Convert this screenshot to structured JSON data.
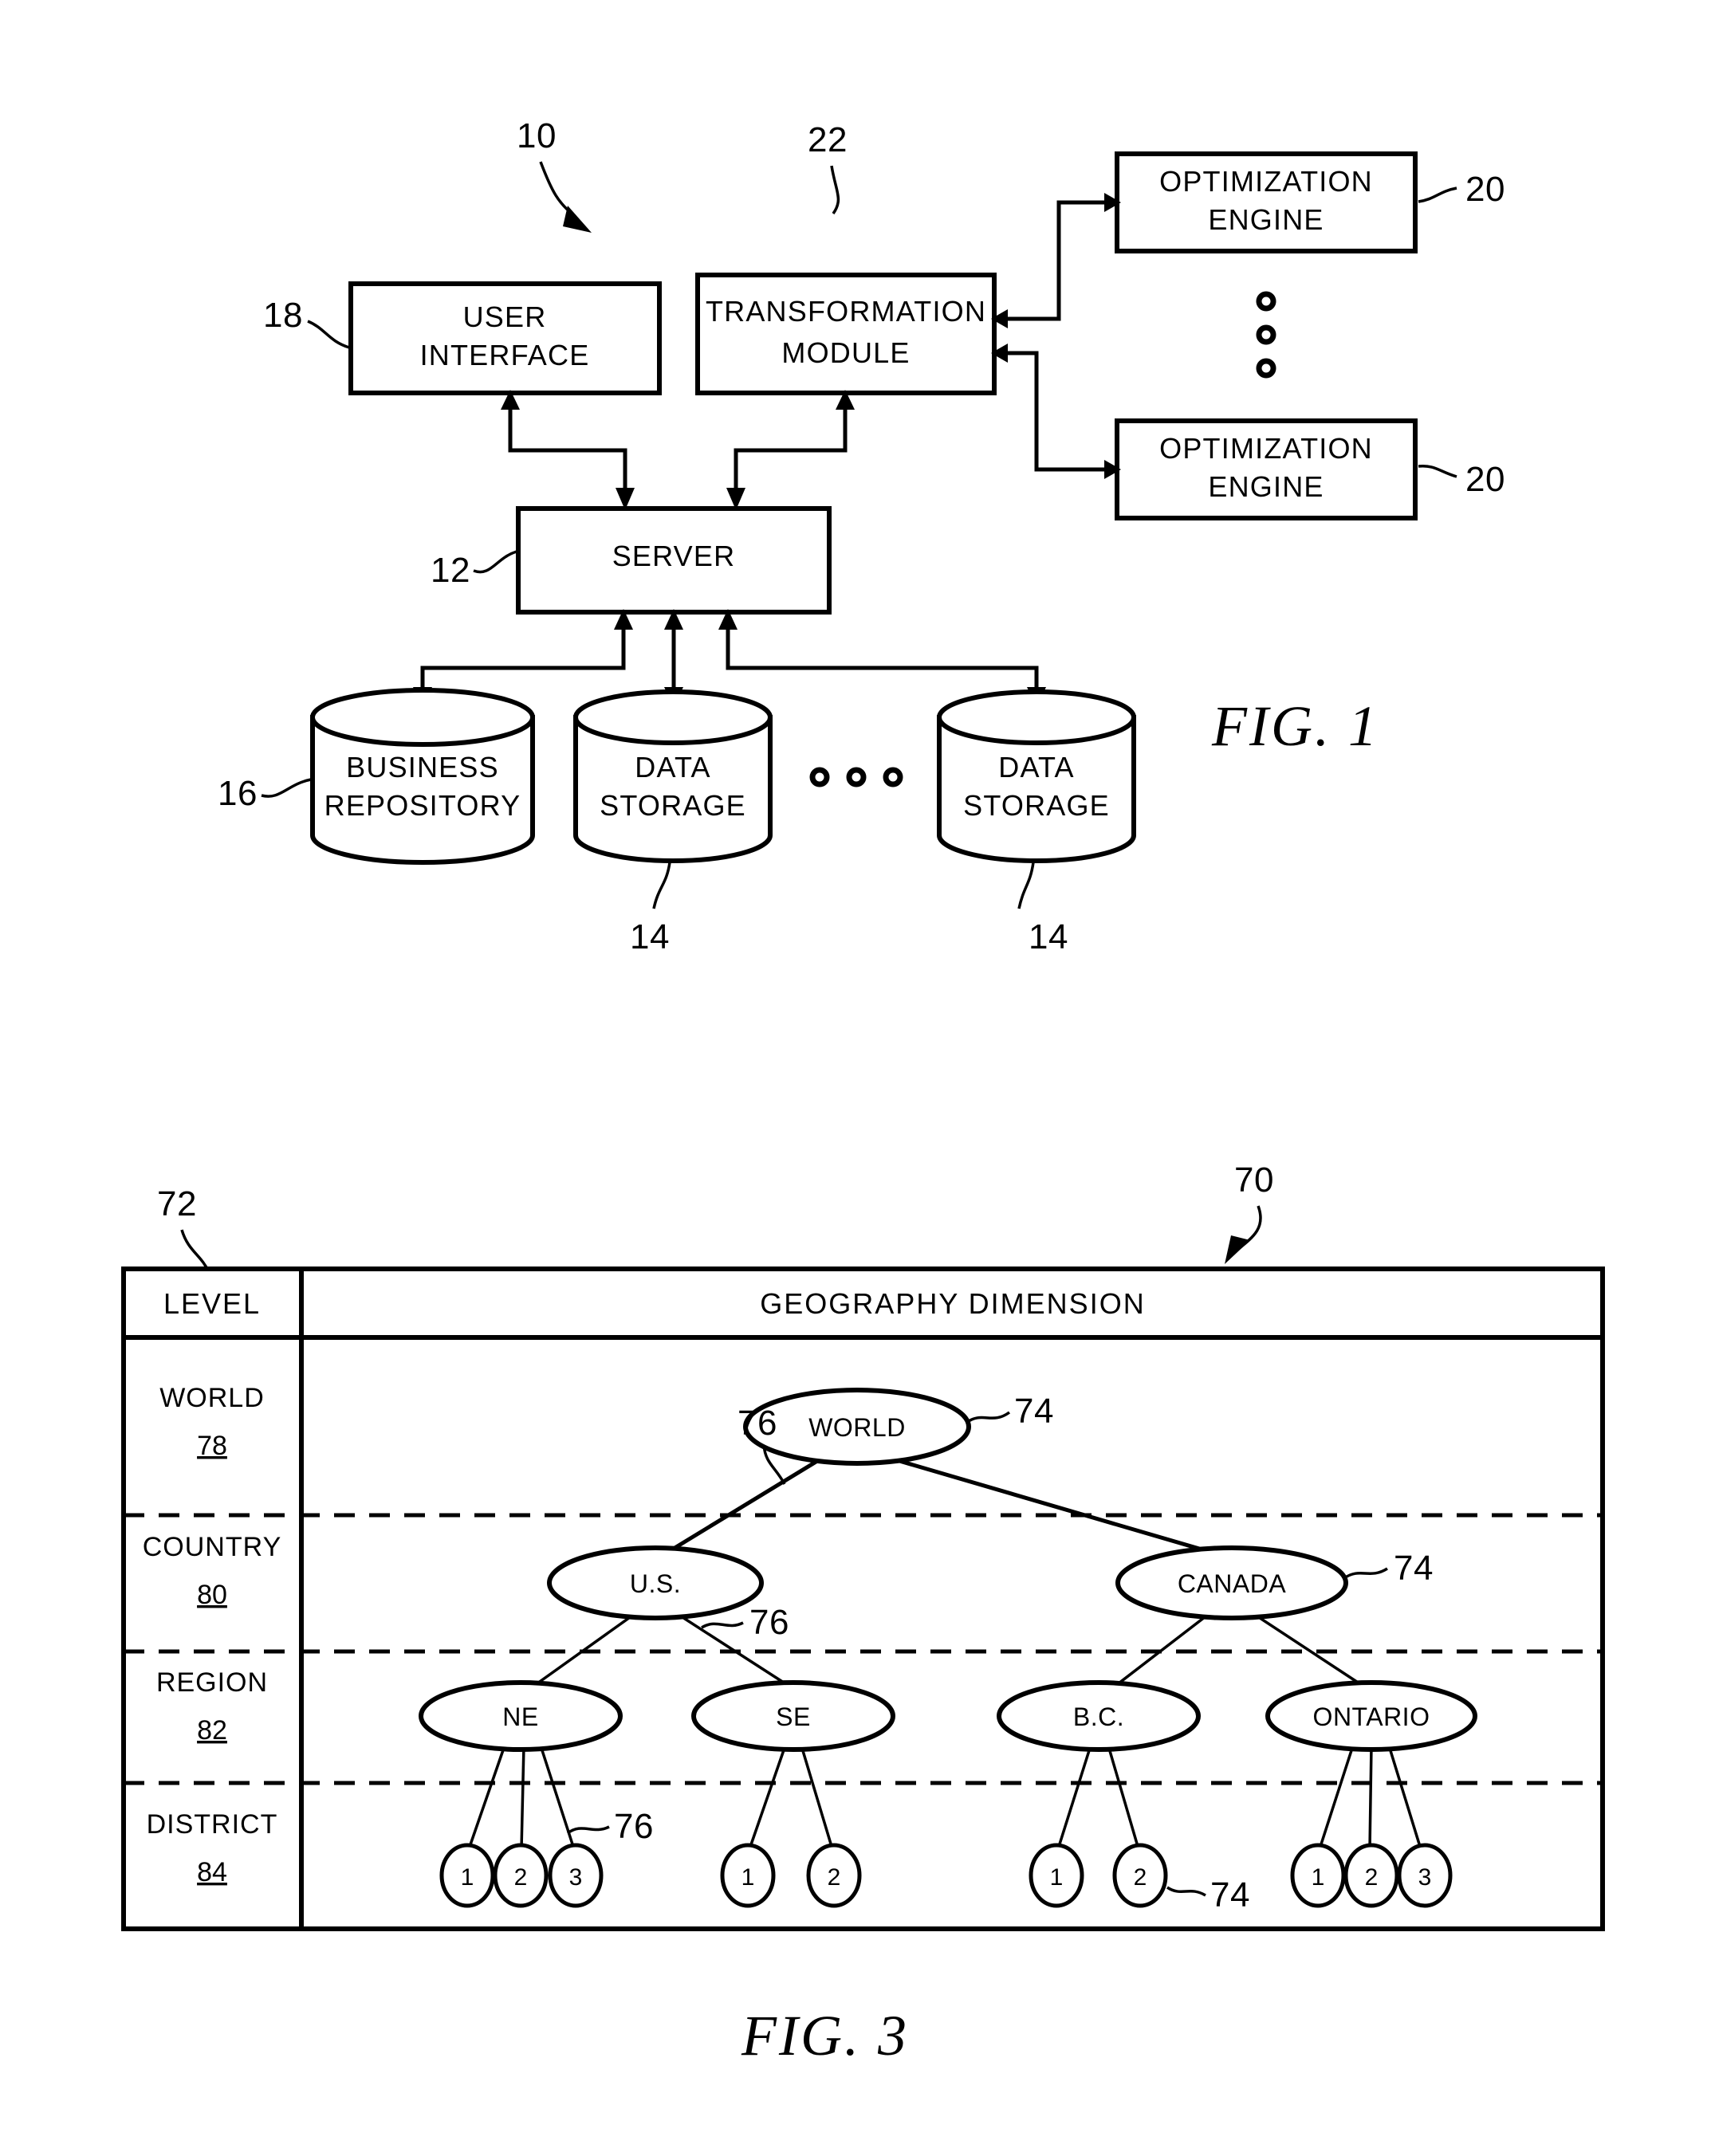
{
  "document": {
    "type": "patent-drawing-sheet",
    "figures": [
      "FIG. 1",
      "FIG. 3"
    ]
  },
  "fig1": {
    "title": "FIG.   1",
    "system_ref": "10",
    "boxes": [
      {
        "id": "user_interface",
        "label_line1": "USER",
        "label_line2": "INTERFACE",
        "ref": "18"
      },
      {
        "id": "transformation_module",
        "label_line1": "TRANSFORMATION",
        "label_line2": "MODULE",
        "ref": "22"
      },
      {
        "id": "optimization_engine_top",
        "label_line1": "OPTIMIZATION",
        "label_line2": "ENGINE",
        "ref": "20"
      },
      {
        "id": "optimization_engine_bottom",
        "label_line1": "OPTIMIZATION",
        "label_line2": "ENGINE",
        "ref": "20"
      },
      {
        "id": "server",
        "label_line1": "SERVER",
        "label_line2": "",
        "ref": "12"
      }
    ],
    "cylinders": [
      {
        "id": "business_repository",
        "label_line1": "BUSINESS",
        "label_line2": "REPOSITORY",
        "ref": "16"
      },
      {
        "id": "data_storage_1",
        "label_line1": "DATA",
        "label_line2": "STORAGE",
        "ref": "14"
      },
      {
        "id": "data_storage_n",
        "label_line1": "DATA",
        "label_line2": "STORAGE",
        "ref": "14"
      }
    ],
    "ellipsis_horizontal": "o o o",
    "ellipsis_vertical": "o o o"
  },
  "fig3": {
    "title": "FIG.   3",
    "table_ref": "70",
    "level_column_ref": "72",
    "node_ref": "74",
    "edge_ref": "76",
    "columns": [
      "LEVEL",
      "GEOGRAPHY DIMENSION"
    ],
    "levels": [
      {
        "name": "WORLD",
        "ref": "78"
      },
      {
        "name": "COUNTRY",
        "ref": "80"
      },
      {
        "name": "REGION",
        "ref": "82"
      },
      {
        "name": "DISTRICT",
        "ref": "84"
      }
    ],
    "tree": {
      "root": "WORLD",
      "countries": [
        "U.S.",
        "CANADA"
      ],
      "regions": [
        "NE",
        "SE",
        "B.C.",
        "ONTARIO"
      ],
      "districts": {
        "NE": [
          "1",
          "2",
          "3"
        ],
        "SE": [
          "1",
          "2"
        ],
        "B.C.": [
          "1",
          "2"
        ],
        "ONTARIO": [
          "1",
          "2",
          "3"
        ]
      }
    },
    "nodes": [
      {
        "key": "world",
        "label": "WORLD"
      },
      {
        "key": "us",
        "label": "U.S."
      },
      {
        "key": "canada",
        "label": "CANADA"
      },
      {
        "key": "ne",
        "label": "NE"
      },
      {
        "key": "se",
        "label": "SE"
      },
      {
        "key": "bc",
        "label": "B.C."
      },
      {
        "key": "ontario",
        "label": "ONTARIO"
      }
    ],
    "leaves": [
      {
        "key": "ne1",
        "label": "1"
      },
      {
        "key": "ne2",
        "label": "2"
      },
      {
        "key": "ne3",
        "label": "3"
      },
      {
        "key": "se1",
        "label": "1"
      },
      {
        "key": "se2",
        "label": "2"
      },
      {
        "key": "bc1",
        "label": "1"
      },
      {
        "key": "bc2",
        "label": "2"
      },
      {
        "key": "on1",
        "label": "1"
      },
      {
        "key": "on2",
        "label": "2"
      },
      {
        "key": "on3",
        "label": "3"
      }
    ],
    "callouts": [
      {
        "key": "world_74",
        "label": "74"
      },
      {
        "key": "world_76",
        "label": "76"
      },
      {
        "key": "canada_74",
        "label": "74"
      },
      {
        "key": "us_76",
        "label": "76"
      },
      {
        "key": "ne_76",
        "label": "76"
      },
      {
        "key": "bc_74",
        "label": "74"
      }
    ]
  },
  "colors": {
    "ink": "#000000",
    "paper": "#ffffff"
  }
}
